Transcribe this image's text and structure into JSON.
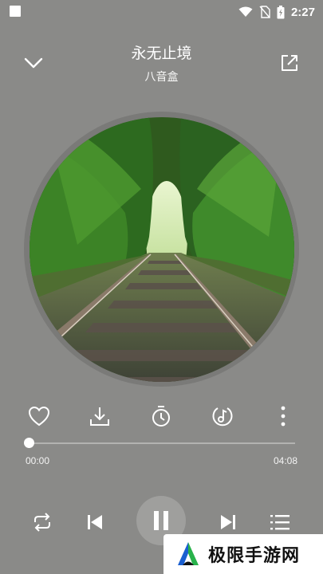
{
  "status_bar": {
    "time": "2:27"
  },
  "header": {
    "title": "永无止境",
    "artist": "八音盒"
  },
  "player": {
    "current_time": "00:00",
    "total_time": "04:08",
    "progress": 0.0
  },
  "actions": {
    "icons": [
      "heart-icon",
      "download-icon",
      "timer-icon",
      "note-icon",
      "more-vertical-icon"
    ]
  },
  "controls": {
    "icons": [
      "repeat-icon",
      "previous-icon",
      "pause-icon",
      "next-icon",
      "playlist-icon"
    ],
    "state": "playing"
  },
  "watermark": {
    "text": "极限手游网"
  },
  "colors": {
    "background": "#8a8a88",
    "foreground": "#ffffff",
    "brand_blue": "#1a5fd0",
    "brand_green": "#28b24b"
  }
}
